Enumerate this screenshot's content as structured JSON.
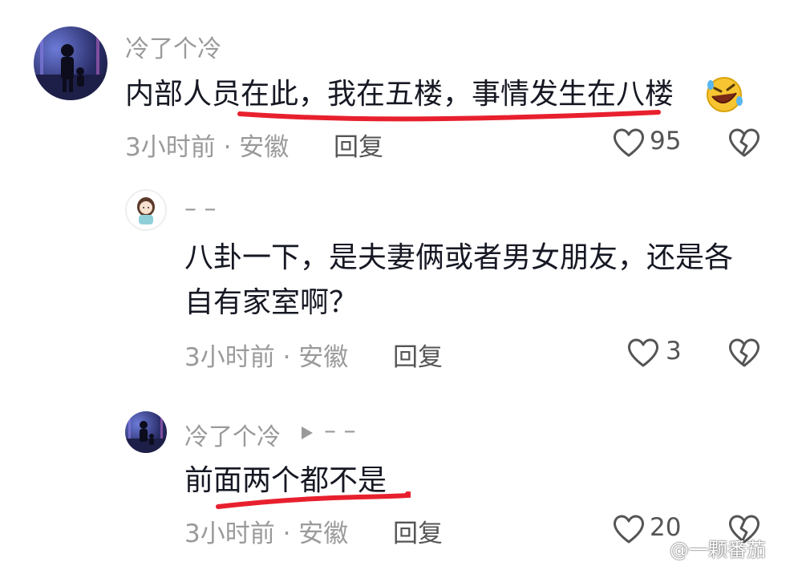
{
  "comments": [
    {
      "username": "冷了个冷",
      "text": "内部人员在此，我在五楼，事情发生在八楼",
      "emoji": "rolling-laughing-emoji",
      "time": "3小时前 · 安徽",
      "reply_label": "回复",
      "likes": "95"
    },
    {
      "username": "–    –",
      "text_line1": "八卦一下，是夫妻俩或者男女朋友，还是各",
      "text_line2": "自有家室啊？",
      "time": "3小时前 · 安徽",
      "reply_label": "回复",
      "likes": "3"
    },
    {
      "username": "冷了个冷",
      "reply_to": "–    –",
      "text": "前面两个都不是",
      "time": "3小时前 · 安徽",
      "reply_label": "回复",
      "likes": "20"
    }
  ],
  "watermark": "@一颗番茄",
  "colors": {
    "underline": "#e8202e",
    "meta_gray": "#9a9a9a",
    "text": "#161823"
  }
}
